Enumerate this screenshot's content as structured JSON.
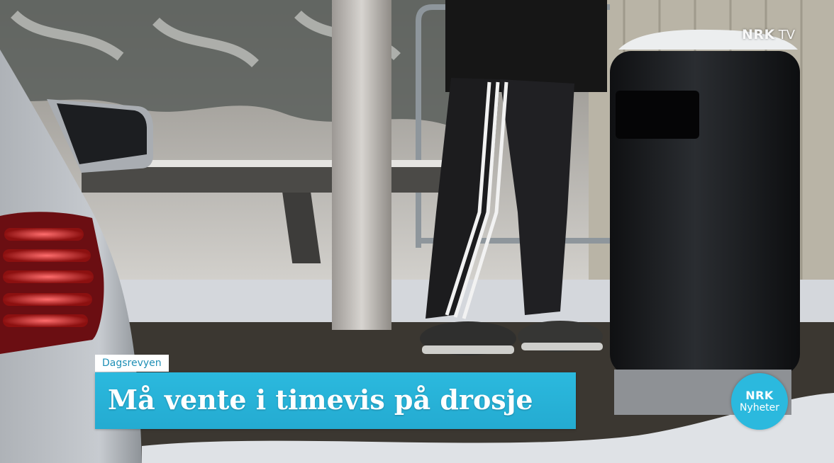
{
  "watermark": {
    "brand": "NRK",
    "service": "TV"
  },
  "lower_third": {
    "program": "Dagsrevyen",
    "headline": "Må vente i timevis på drosje"
  },
  "channel_logo": {
    "brand": "NRK",
    "name": "Nyheter"
  },
  "colors": {
    "accent": "#2bb9de",
    "label_text": "#1f8fb6"
  }
}
